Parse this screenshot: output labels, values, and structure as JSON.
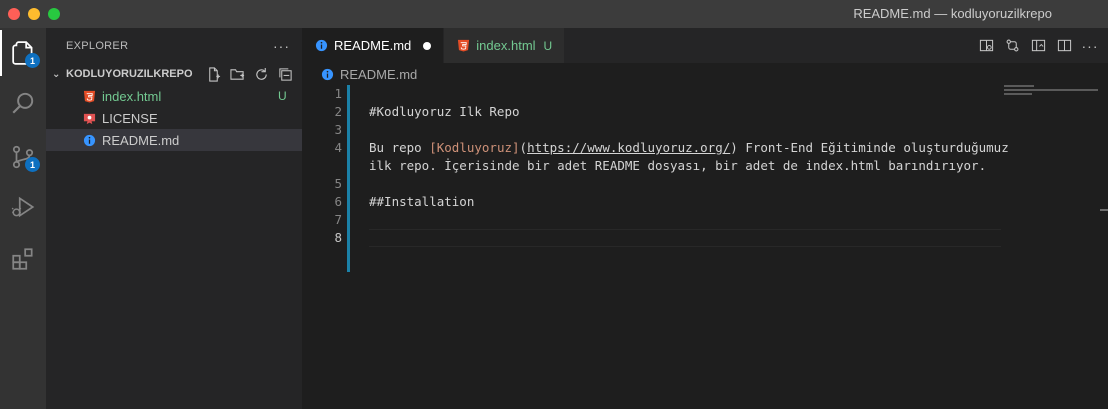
{
  "window": {
    "title": "README.md — kodluyoruzilkrepo"
  },
  "activity_bar": {
    "items": [
      {
        "name": "explorer",
        "icon": "files-icon",
        "badge": "1",
        "active": true
      },
      {
        "name": "search",
        "icon": "search-icon",
        "badge": null
      },
      {
        "name": "source-control",
        "icon": "source-control-icon",
        "badge": "1"
      },
      {
        "name": "run-debug",
        "icon": "run-debug-icon",
        "badge": null
      },
      {
        "name": "extensions",
        "icon": "extensions-icon",
        "badge": null
      }
    ]
  },
  "sidebar": {
    "header": "EXPLORER",
    "more": "···",
    "folder": {
      "name": "KODLUYORUZILKREPO",
      "actions": [
        "new-file-icon",
        "new-folder-icon",
        "refresh-icon",
        "collapse-all-icon"
      ]
    },
    "files": [
      {
        "name": "index.html",
        "icon": "html5-icon",
        "git_status": "U"
      },
      {
        "name": "LICENSE",
        "icon": "license-icon",
        "git_status": ""
      },
      {
        "name": "README.md",
        "icon": "info-icon",
        "git_status": "",
        "selected": true
      }
    ]
  },
  "tabs": [
    {
      "label": "README.md",
      "icon": "info-icon",
      "active": true,
      "modified": true
    },
    {
      "label": "index.html",
      "icon": "html5-icon",
      "active": false,
      "git_status": "U"
    }
  ],
  "tab_actions": [
    "open-preview-icon",
    "open-changes-icon",
    "preview-side-icon",
    "split-editor-icon"
  ],
  "tab_more": "···",
  "breadcrumb": {
    "file": "README.md"
  },
  "editor": {
    "lines": [
      {
        "num": "1",
        "text": ""
      },
      {
        "num": "2",
        "text": "#Kodluyoruz Ilk Repo"
      },
      {
        "num": "3",
        "text": ""
      },
      {
        "num": "4",
        "prefix": "Bu repo ",
        "link_text": "[Kodluyoruz]",
        "paren_open": "(",
        "url": "https://www.kodluyoruz.org/",
        "paren_close": ")",
        "suffix": " Front-End Eğitiminde oluşturduğumuz"
      },
      {
        "num": "",
        "text": "ilk repo. İçerisinde bir adet README dosyası, bir adet de index.html barındırıyor."
      },
      {
        "num": "5",
        "text": ""
      },
      {
        "num": "6",
        "text": "##Installation"
      },
      {
        "num": "7",
        "text": ""
      },
      {
        "num": "8",
        "text": "",
        "current": true
      }
    ]
  },
  "colors": {
    "accent": "#0e70c0",
    "untracked": "#73c991",
    "html_icon": "#e44d26",
    "info_icon": "#3794ff",
    "license_icon": "#e05252",
    "link_text": "#ce9178"
  }
}
